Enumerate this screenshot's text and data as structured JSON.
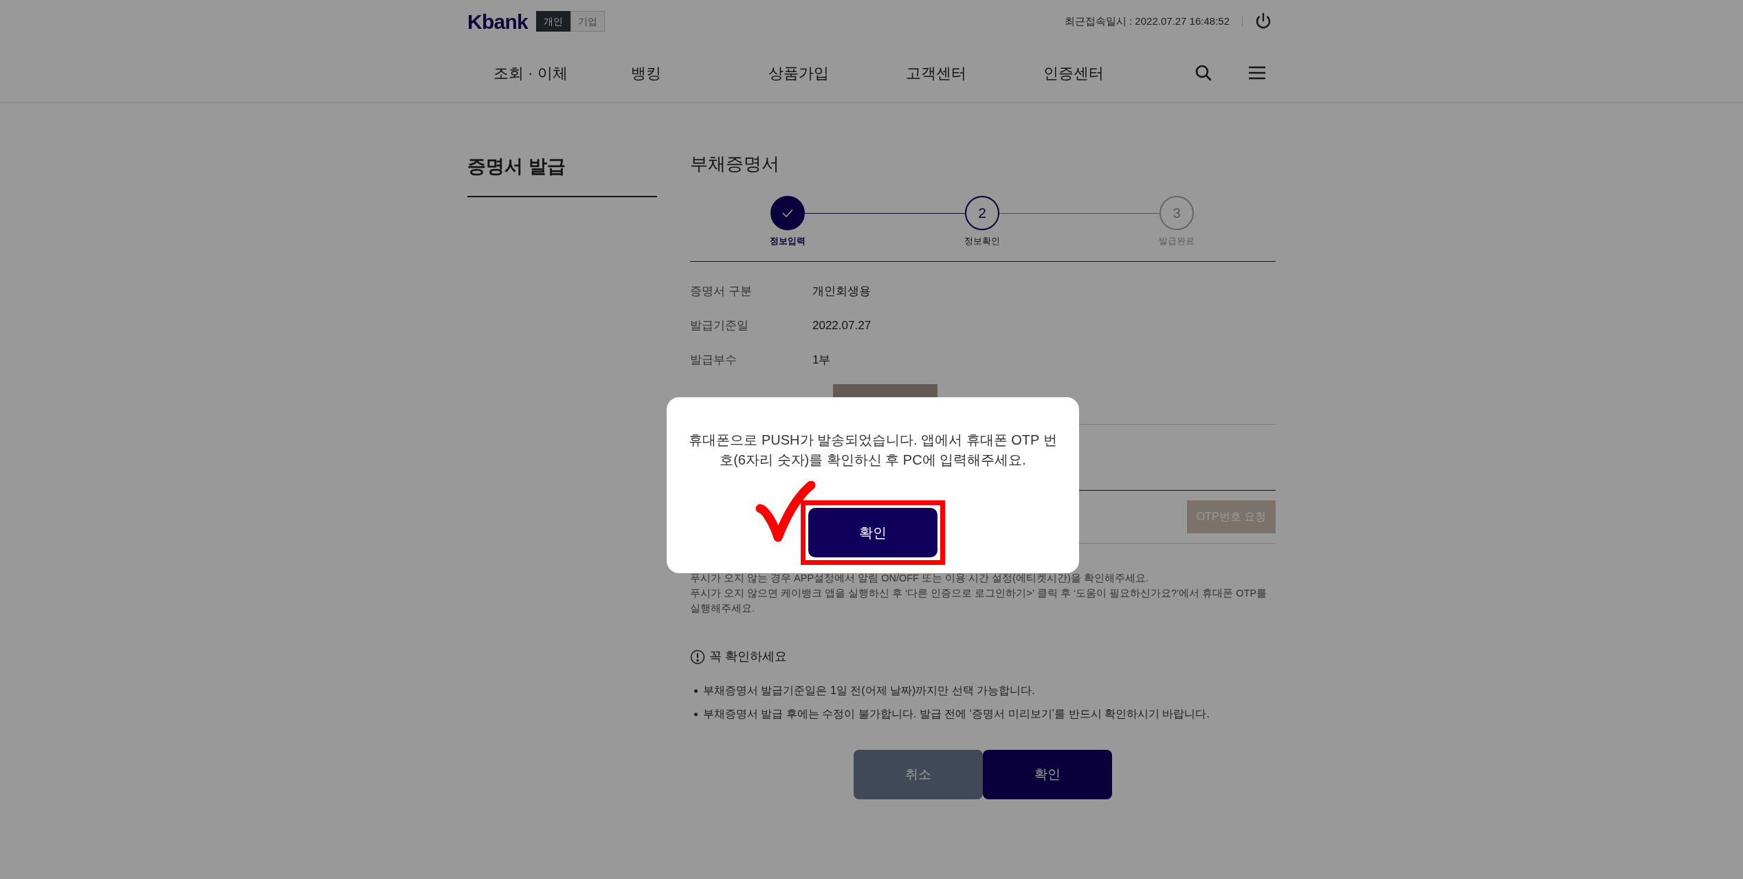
{
  "header": {
    "logo": "Kbank",
    "segments": [
      {
        "label": "개인",
        "selected": true
      },
      {
        "label": "기업",
        "selected": false
      }
    ],
    "last_login": "최근접속일시 : 2022.07.27 16:48:52"
  },
  "nav": [
    "조회 · 이체",
    "뱅킹",
    "상품가입",
    "고객센터",
    "인증센터"
  ],
  "sidebar": {
    "title": "증명서 발급"
  },
  "main": {
    "title": "부채증명서",
    "steps": [
      {
        "label": "정보입력",
        "done": true,
        "current": false
      },
      {
        "label": "정보확인",
        "number": "2",
        "done": false,
        "current": true
      },
      {
        "label": "발급완료",
        "number": "3",
        "done": false,
        "current": false
      }
    ],
    "fields": [
      {
        "label": "증명서 구분",
        "value": "개인회생용"
      },
      {
        "label": "발급기준일",
        "value": "2022.07.27"
      },
      {
        "label": "발급부수",
        "value": "1부"
      }
    ],
    "preview": {
      "kind": "button"
    },
    "otp_button": "OTP번호 요청",
    "notes": [
      "푸시가 오지 않는 경우 APP설정에서 알림 ON/OFF 또는 이용 시간 설정(에티켓시간)을 확인해주세요.",
      "푸시가 오지 않으면 케이뱅크 앱을 실행하신 후 ‘다른 인증으로 로그인하기>’ 클릭 후 ‘도움이 필요하신가요?’에서 휴대폰 OTP를 실행해주세요."
    ],
    "notice": {
      "title": "꼭 확인하세요",
      "items": [
        "부채증명서 발급기준일은 1일 전(어제 날짜)까지만 선택 가능합니다.",
        "부채증명서 발급 후에는 수정이 불가합니다. 발급 전에 ‘증명서 미리보기’를 반드시 확인하시기 바랍니다."
      ]
    },
    "buttons": [
      {
        "label": "취소",
        "kind": "secondary"
      },
      {
        "label": "확인",
        "kind": "primary"
      }
    ]
  },
  "dialog": {
    "message": "휴대폰으로 PUSH가 발송되었습니다. 앱에서 휴대폰 OTP 번호(6자리 숫자)를 확인하신 후 PC에 입력해주세요.",
    "button": "확인"
  }
}
